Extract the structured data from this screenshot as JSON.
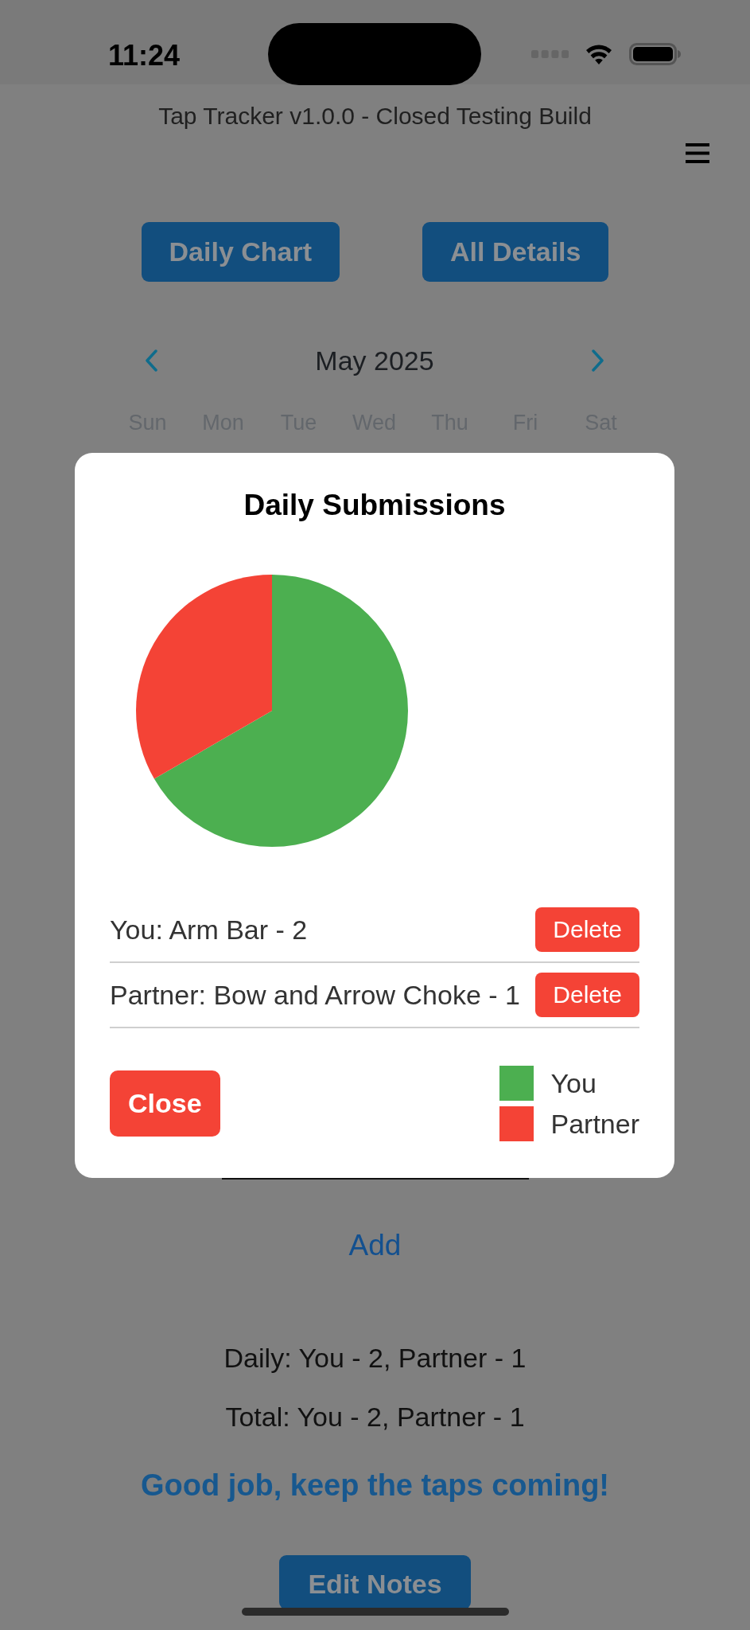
{
  "status_bar": {
    "time": "11:24"
  },
  "header": {
    "title": "Tap Tracker v1.0.0 - Closed Testing Build"
  },
  "nav_buttons": [
    {
      "label": "Daily Chart"
    },
    {
      "label": "All Details"
    }
  ],
  "calendar": {
    "month": "May 2025",
    "weekdays": [
      "Sun",
      "Mon",
      "Tue",
      "Wed",
      "Thu",
      "Fri",
      "Sat"
    ]
  },
  "add_button": {
    "label": "Add"
  },
  "summary": {
    "daily": "Daily: You - 2, Partner - 1",
    "total": "Total: You - 2, Partner - 1",
    "message": "Good job, keep the taps coming!"
  },
  "edit_notes_button": {
    "label": "Edit Notes"
  },
  "modal": {
    "title": "Daily Submissions",
    "chart_data": {
      "type": "pie",
      "categories": [
        "You",
        "Partner"
      ],
      "values": [
        66.67,
        33.33
      ]
    },
    "entries": [
      {
        "text": "You: Arm Bar - 2",
        "action": "Delete"
      },
      {
        "text": "Partner: Bow and Arrow Choke - 1",
        "action": "Delete"
      }
    ],
    "close_button": "Close",
    "legend": [
      {
        "color": "#4caf50"
      },
      {
        "color": "#f44336"
      }
    ]
  }
}
